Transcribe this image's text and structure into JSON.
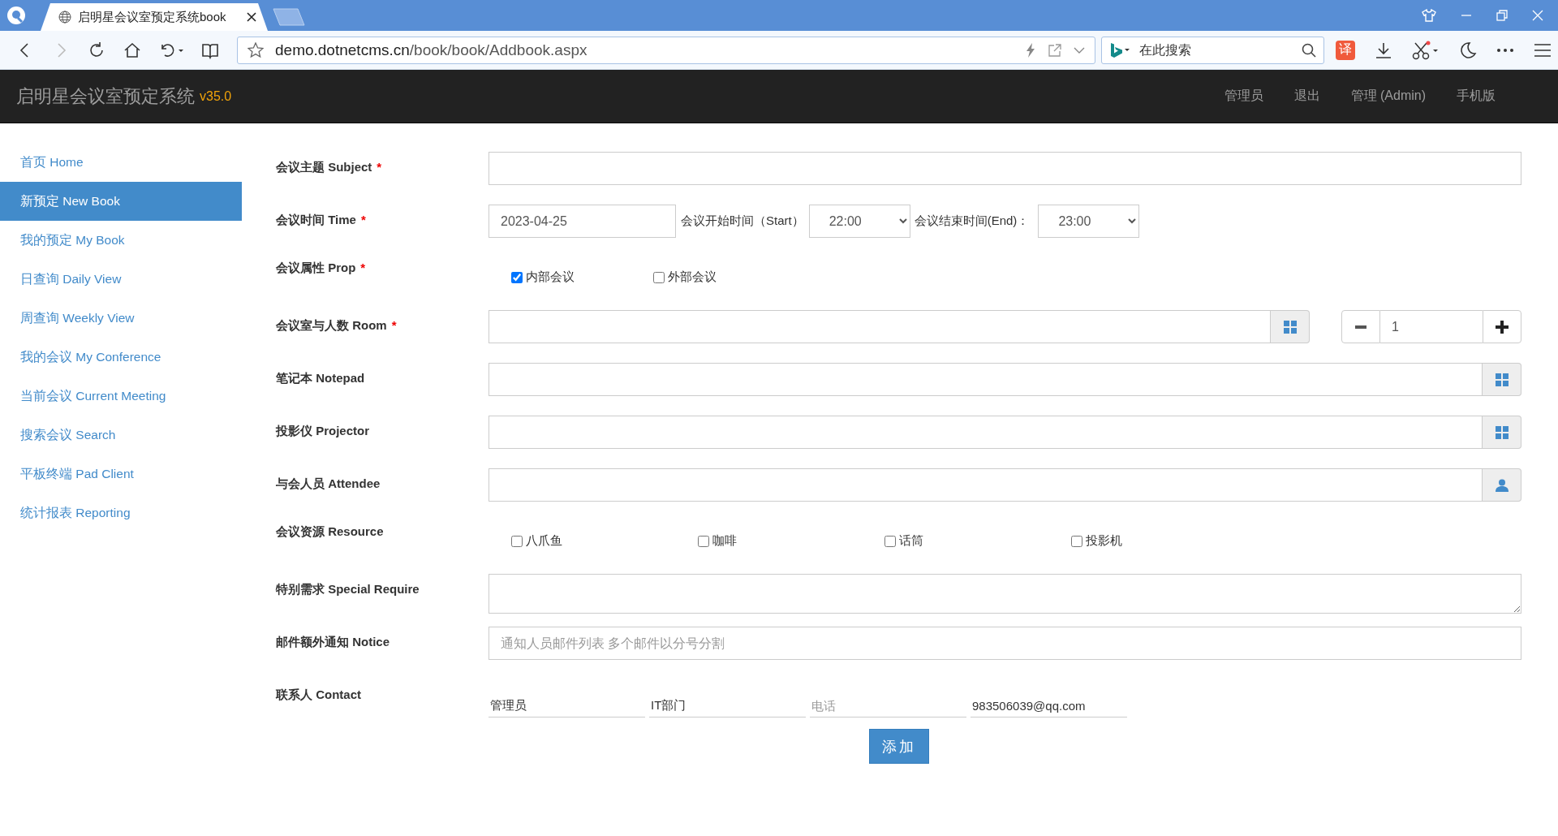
{
  "browser": {
    "tabs": [
      {
        "title": "启明星会议室预定系统book",
        "selected": true
      }
    ],
    "address": {
      "host": "demo.dotnetcms.cn",
      "path": "/book/book/Addbook.aspx"
    },
    "search": {
      "placeholder": "在此搜索"
    },
    "translate_badge": "译"
  },
  "header": {
    "title": "启明星会议室预定系统",
    "version": "v35.0",
    "nav": [
      "管理员",
      "退出",
      "管理 (Admin)",
      "手机版"
    ]
  },
  "sidebar": {
    "items": [
      {
        "label": "首页 Home",
        "selected": false
      },
      {
        "label": "新预定 New Book",
        "selected": true
      },
      {
        "label": "我的预定 My Book",
        "selected": false
      },
      {
        "label": "日查询 Daily View",
        "selected": false
      },
      {
        "label": "周查询 Weekly View",
        "selected": false
      },
      {
        "label": "我的会议 My Conference",
        "selected": false
      },
      {
        "label": "当前会议 Current Meeting",
        "selected": false
      },
      {
        "label": "搜索会议 Search",
        "selected": false
      },
      {
        "label": "平板终端 Pad Client",
        "selected": false
      },
      {
        "label": "统计报表 Reporting",
        "selected": false
      }
    ]
  },
  "form": {
    "fields": [
      {
        "kind": "text",
        "label": "会议主题 Subject",
        "required_mark": "*"
      },
      {
        "kind": "time",
        "label": "会议时间 Time",
        "required_mark": "*",
        "date": "2023-04-25",
        "start_label": "会议开始时间（Start）",
        "start": "22:00",
        "end_label": "会议结束时间(End)：",
        "end": "23:00"
      },
      {
        "kind": "options",
        "label": "会议属性 Prop",
        "required_mark": "*",
        "options": [
          {
            "label": "内部会议",
            "checked": true
          },
          {
            "label": "外部会议",
            "checked": false
          }
        ]
      },
      {
        "kind": "room",
        "label": "会议室与人数 Room",
        "required_mark": "*",
        "count": "1"
      },
      {
        "kind": "picker",
        "label": "笔记本 Notepad"
      },
      {
        "kind": "picker",
        "label": "投影仪 Projector"
      },
      {
        "kind": "person",
        "label": "与会人员 Attendee"
      },
      {
        "kind": "options",
        "label": "会议资源 Resource",
        "options": [
          {
            "label": "八爪鱼",
            "checked": false
          },
          {
            "label": "咖啡",
            "checked": false
          },
          {
            "label": "话筒",
            "checked": false
          },
          {
            "label": "投影机",
            "checked": false
          }
        ]
      },
      {
        "kind": "textarea",
        "label": "特别需求 Special Require"
      },
      {
        "kind": "text",
        "label": "邮件额外通知 Notice",
        "placeholder": "通知人员邮件列表 多个邮件以分号分割"
      },
      {
        "kind": "contact",
        "label": "联系人 Contact",
        "inputs": [
          {
            "value": "管理员"
          },
          {
            "value": "IT部门"
          },
          {
            "placeholder": "电话"
          },
          {
            "value": "983506039@qq.com"
          }
        ]
      }
    ],
    "submit": "添加"
  }
}
